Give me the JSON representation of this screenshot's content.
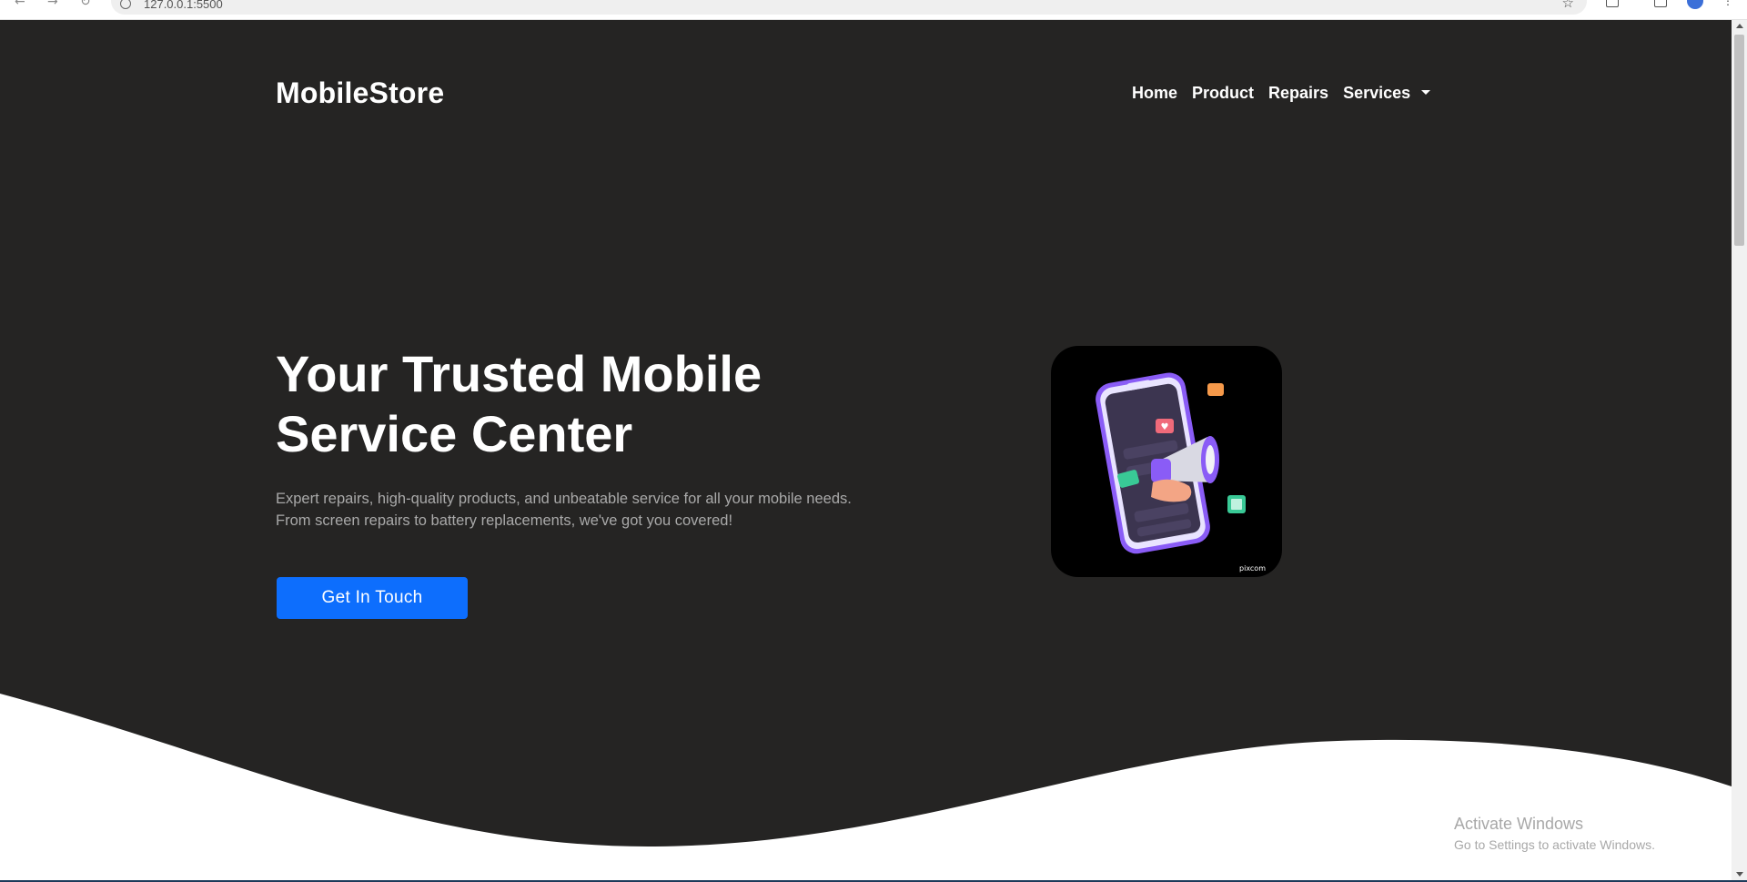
{
  "browser": {
    "url": "127.0.0.1:5500"
  },
  "navbar": {
    "brand": "MobileStore",
    "links": [
      {
        "label": "Home"
      },
      {
        "label": "Product"
      },
      {
        "label": "Repairs"
      },
      {
        "label": "Services"
      }
    ]
  },
  "hero": {
    "headline": "Your Trusted Mobile Service Center",
    "subtext": "Expert repairs, high-quality products, and unbeatable service for all your mobile needs. From screen repairs to battery replacements, we've got you covered!",
    "cta_label": "Get In Touch",
    "illustration": {
      "icon": "phone-megaphone-illustration",
      "watermark": "pixcom"
    }
  },
  "watermark": {
    "title": "Activate Windows",
    "subtitle": "Go to Settings to activate Windows."
  },
  "colors": {
    "hero_background": "#252423",
    "accent": "#0d6efd",
    "text_light": "#ffffff",
    "text_muted": "#a9a9a9"
  }
}
